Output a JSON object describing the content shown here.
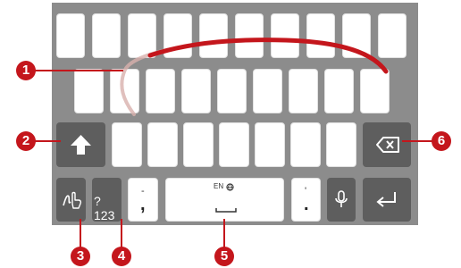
{
  "keyboard": {
    "symbols_key": {
      "label": "?123"
    },
    "space_key": {
      "language": "EN"
    },
    "comma_key": {
      "label": ",",
      "hint": "-"
    },
    "period_key": {
      "label": ".",
      "hint": "'"
    }
  },
  "callouts": [
    "1",
    "2",
    "3",
    "4",
    "5",
    "6"
  ],
  "colors": {
    "keyboard_background": "#8c8c8c",
    "letter_key": "#ffffff",
    "function_key": "#5e5e5e",
    "callout": "#c4161c",
    "swipe_trail": "#c4161c"
  },
  "icons": {
    "shift": "shift-arrow-icon",
    "backspace": "backspace-icon",
    "handwriting": "handwriting-icon",
    "microphone": "microphone-icon",
    "enter": "enter-icon",
    "globe": "globe-icon"
  }
}
